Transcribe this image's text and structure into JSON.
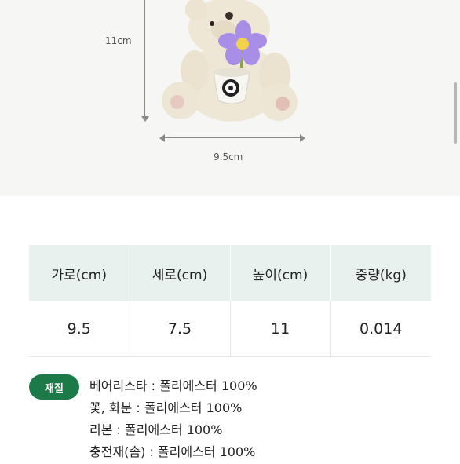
{
  "product": {
    "height_label": "11cm",
    "width_label": "9.5cm"
  },
  "spec_table": {
    "headers": [
      "가로(cm)",
      "세로(cm)",
      "높이(cm)",
      "중량(kg)"
    ],
    "values": [
      "9.5",
      "7.5",
      "11",
      "0.014"
    ]
  },
  "material": {
    "badge": "재질",
    "lines": [
      "베어리스타 : 폴리에스터 100%",
      "꽃, 화분 : 폴리에스터 100%",
      "리본 : 폴리에스터 100%",
      "충전재(솜) : 폴리에스터 100%"
    ]
  },
  "colors": {
    "header_bg": "#e9f1ef",
    "badge_bg": "#1b7a47",
    "flower": "#a98ee8"
  }
}
